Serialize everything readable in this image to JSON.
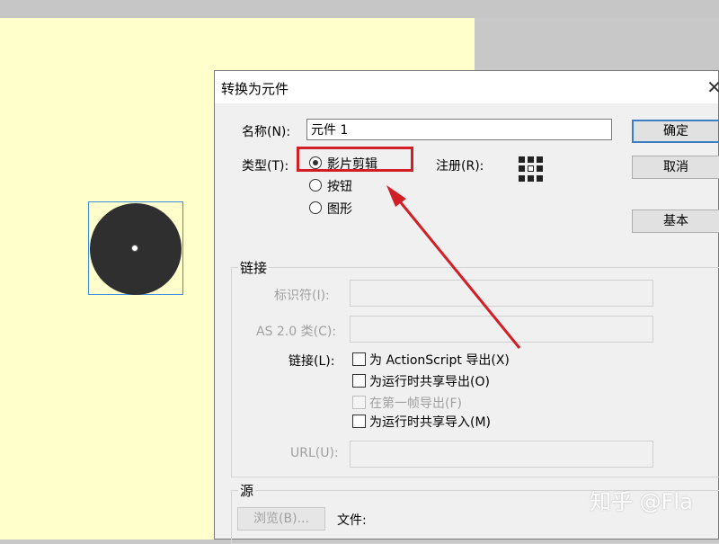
{
  "dialog": {
    "title": "转换为元件",
    "name_label": "名称(N):",
    "name_value": "元件 1",
    "type_label": "类型(T):",
    "type_options": [
      {
        "label": "影片剪辑",
        "checked": true
      },
      {
        "label": "按钮",
        "checked": false
      },
      {
        "label": "图形",
        "checked": false
      }
    ],
    "registration_label": "注册(R):",
    "buttons": {
      "ok": "确定",
      "cancel": "取消",
      "basic": "基本"
    },
    "linkage": {
      "section_title": "链接",
      "identifier_label": "标识符(I):",
      "identifier_value": "",
      "as_class_label": "AS 2.0 类(C):",
      "as_class_value": "",
      "linkage_label": "链接(L):",
      "options": [
        {
          "label": "为 ActionScript 导出(X)",
          "checked": false,
          "enabled": true
        },
        {
          "label": "为运行时共享导出(O)",
          "checked": false,
          "enabled": true
        },
        {
          "label": "在第一帧导出(F)",
          "checked": false,
          "enabled": false
        },
        {
          "label": "为运行时共享导入(M)",
          "checked": false,
          "enabled": true
        }
      ],
      "url_label": "URL(U):",
      "url_value": ""
    },
    "source": {
      "section_title": "源",
      "browse_label": "浏览(B)...",
      "file_label": "文件:"
    }
  },
  "watermark": "知乎 @Fla",
  "colors": {
    "stage": "#ffffcc",
    "highlight": "#d11f25",
    "circle": "#2f2f2f"
  }
}
